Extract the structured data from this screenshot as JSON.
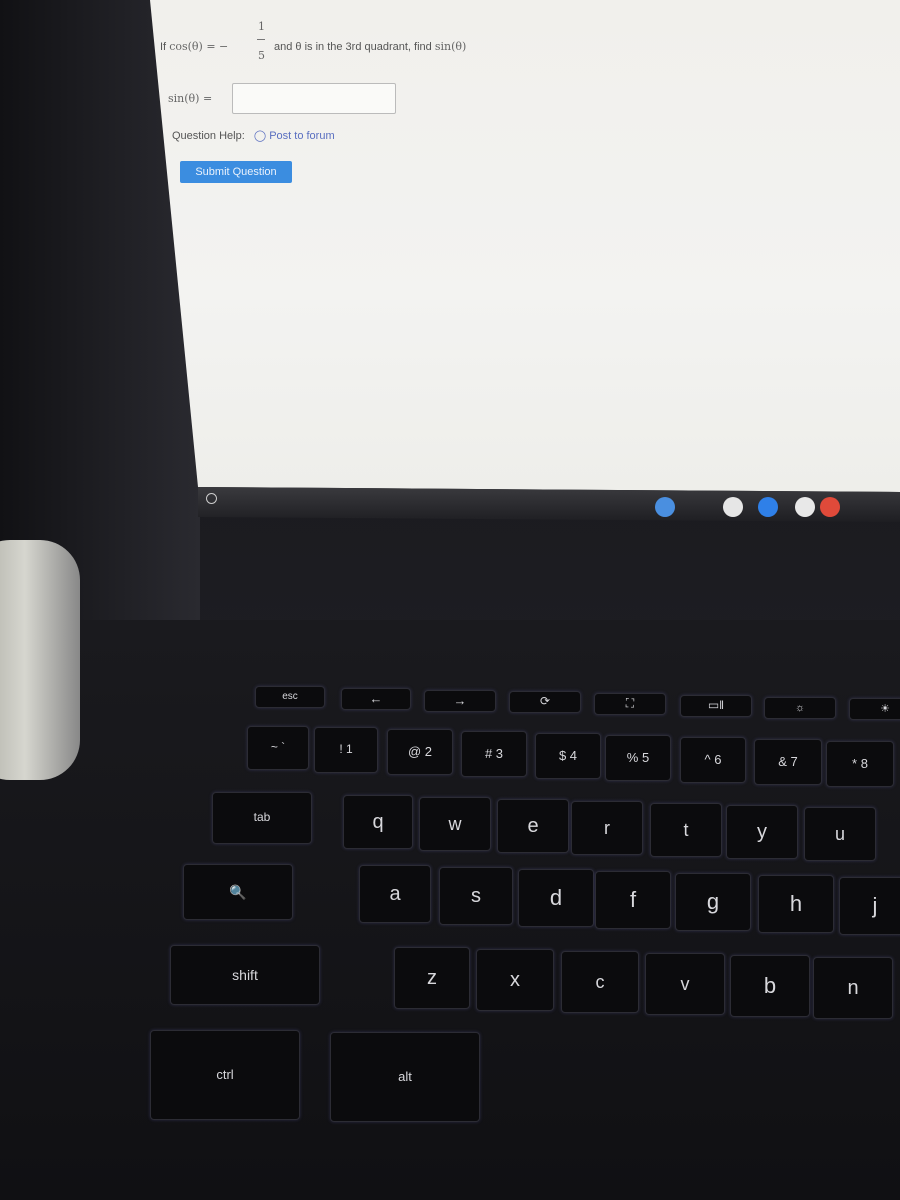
{
  "question": {
    "prefix": "If",
    "cos_expr": "cos(θ) = −",
    "numerator": "1",
    "denominator": "5",
    "rest": "and θ is in the 3rd quadrant, find",
    "find_expr": "sin(θ)",
    "answer_label": "sin(θ) =",
    "answer_value": "",
    "help_label": "Question Help:",
    "forum_link": "Post to forum",
    "submit_label": "Submit Question"
  },
  "shelf": {
    "apps": [
      {
        "icon": "chrome-icon",
        "color": "#4a8fe0"
      },
      {
        "icon": "gmail-icon",
        "color": "#e6e6e6"
      },
      {
        "icon": "files-icon",
        "color": "#2f80e8"
      },
      {
        "icon": "play-store-icon",
        "color": "#e8e8e8"
      },
      {
        "icon": "youtube-icon",
        "color": "#e04a3a"
      }
    ]
  },
  "keyboard": {
    "keys": [
      "esc",
      "←",
      "→",
      "⟳",
      "⛶",
      "▭‖",
      "☼",
      "☀",
      "~ `",
      "! 1",
      "@ 2",
      "# 3",
      "$ 4",
      "% 5",
      "^ 6",
      "& 7",
      "* 8",
      "tab",
      "q",
      "w",
      "e",
      "r",
      "t",
      "y",
      "u",
      "🔍",
      "a",
      "s",
      "d",
      "f",
      "g",
      "h",
      "j",
      "shift",
      "z",
      "x",
      "c",
      "v",
      "b",
      "n",
      "ctrl",
      "alt"
    ]
  }
}
